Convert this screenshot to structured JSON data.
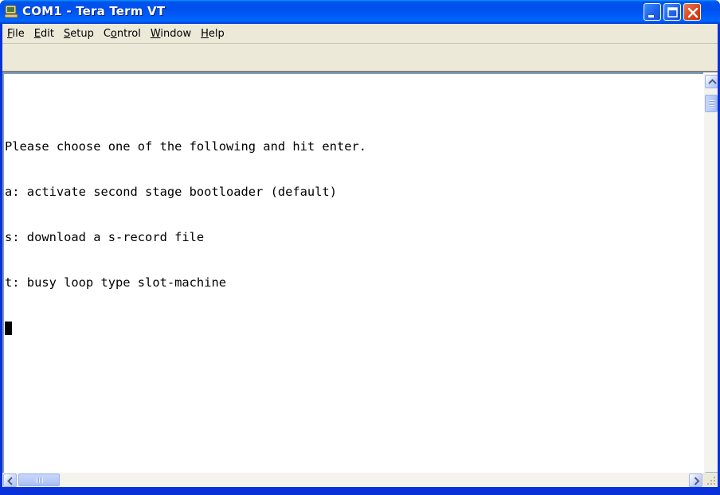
{
  "window": {
    "title": "COM1 - Tera Term VT",
    "app_icon": "tera-term-app-icon",
    "controls": {
      "minimize_icon": "minimize-icon",
      "maximize_icon": "maximize-icon",
      "close_icon": "close-icon"
    }
  },
  "menu": {
    "items": [
      {
        "label": "File",
        "accelerator": "F"
      },
      {
        "label": "Edit",
        "accelerator": "E"
      },
      {
        "label": "Setup",
        "accelerator": "S"
      },
      {
        "label": "Control",
        "accelerator": "o"
      },
      {
        "label": "Window",
        "accelerator": "W"
      },
      {
        "label": "Help",
        "accelerator": "H"
      }
    ]
  },
  "terminal": {
    "lines": [
      "Please choose one of the following and hit enter.",
      "a: activate second stage bootloader (default)",
      "s: download a s-record file",
      "t: busy loop type slot-machine"
    ],
    "cursor": "block-cursor"
  },
  "scrollbars": {
    "vertical": {
      "up_icon": "scroll-up-arrow-icon",
      "down_icon": "scroll-down-arrow-icon"
    },
    "horizontal": {
      "left_icon": "scroll-left-arrow-icon",
      "right_icon": "scroll-right-arrow-icon"
    }
  },
  "colors": {
    "titlebar": "#0054e3",
    "window_border": "#0831d9",
    "menu_bg": "#ece9d8",
    "terminal_bg": "#ffffff",
    "terminal_fg": "#000000",
    "close_button": "#d9471d"
  }
}
